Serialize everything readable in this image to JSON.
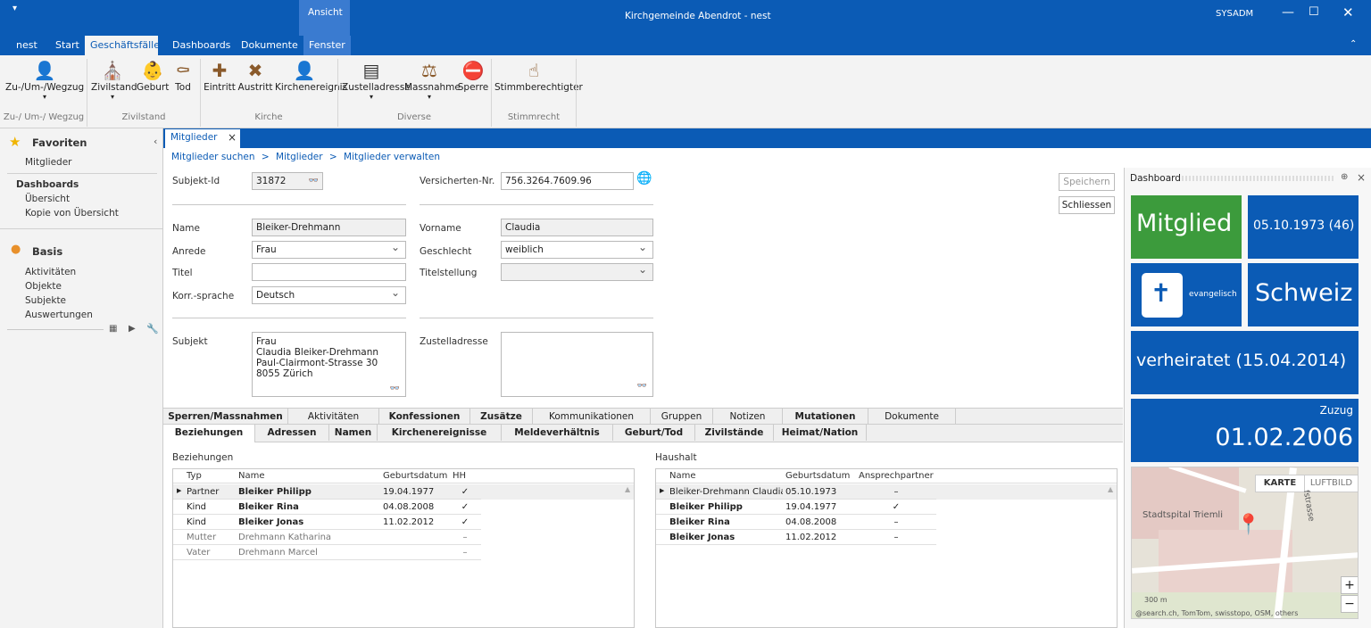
{
  "window": {
    "title": "Kirchgemeinde Abendrot - nest",
    "context_tab": "Ansicht",
    "user": "SYSADM",
    "quick_access": "▾"
  },
  "menu": {
    "tabs": [
      "nest",
      "Start",
      "Geschäftsfälle",
      "Dashboards",
      "Dokumente",
      "Fenster"
    ],
    "active": "Geschäftsfälle"
  },
  "ribbon": {
    "buttons": [
      "Zu-/Um-/Wegzug",
      "Zivilstand",
      "Geburt",
      "Tod",
      "Eintritt",
      "Austritt",
      "Kirchenereignis",
      "Zustelladresse",
      "Massnahme",
      "Sperre",
      "Stimmberechtigter"
    ],
    "groups": [
      "Zu-/ Um-/ Wegzug",
      "Zivilstand",
      "Kirche",
      "Diverse",
      "Stimmrecht"
    ]
  },
  "left": {
    "favorites_title": "Favoriten",
    "favorites_items": [
      "Mitglieder"
    ],
    "dashboards_title": "Dashboards",
    "dashboards_items": [
      "Übersicht",
      "Kopie von Übersicht"
    ],
    "basis_title": "Basis",
    "basis_items": [
      "Aktivitäten",
      "Objekte",
      "Subjekte",
      "Auswertungen"
    ]
  },
  "doc_tab": {
    "label": "Mitglieder",
    "close": "×"
  },
  "breadcrumb": [
    "Mitglieder suchen",
    ">",
    "Mitglieder",
    ">",
    "Mitglieder verwalten"
  ],
  "form": {
    "subjekt_id": {
      "label": "Subjekt-Id",
      "value": "31872"
    },
    "versicherten_nr": {
      "label": "Versicherten-Nr.",
      "value": "756.3264.7609.96"
    },
    "name": {
      "label": "Name",
      "value": "Bleiker-Drehmann"
    },
    "vorname": {
      "label": "Vorname",
      "value": "Claudia"
    },
    "anrede": {
      "label": "Anrede",
      "value": "Frau"
    },
    "geschlecht": {
      "label": "Geschlecht",
      "value": "weiblich"
    },
    "titel": {
      "label": "Titel",
      "value": ""
    },
    "titelstellung": {
      "label": "Titelstellung",
      "value": ""
    },
    "korr_sprache": {
      "label": "Korr.-sprache",
      "value": "Deutsch"
    },
    "subjekt": {
      "label": "Subjekt",
      "lines": [
        "Frau",
        "Claudia Bleiker-Drehmann",
        "Paul-Clairmont-Strasse 30",
        "8055 Zürich"
      ]
    },
    "zustelladresse": {
      "label": "Zustelladresse",
      "value": ""
    }
  },
  "actions": {
    "save": "Speichern",
    "close": "Schliessen"
  },
  "subtabs_row1": [
    "Sperren/Massnahmen",
    "Aktivitäten",
    "Konfessionen",
    "Zusätze",
    "Kommunikationen",
    "Gruppen",
    "Notizen",
    "Mutationen",
    "Dokumente"
  ],
  "subtabs_row2": [
    "Beziehungen",
    "Adressen",
    "Namen",
    "Kirchenereignisse",
    "Meldeverhältnis",
    "Geburt/Tod",
    "Zivilstände",
    "Heimat/Nation"
  ],
  "beziehungen": {
    "title": "Beziehungen",
    "columns": [
      "Typ",
      "Name",
      "Geburtsdatum",
      "HH"
    ],
    "rows": [
      [
        "Partner",
        "Bleiker Philipp",
        "19.04.1977",
        "✓"
      ],
      [
        "Kind",
        "Bleiker Rina",
        "04.08.2008",
        "✓"
      ],
      [
        "Kind",
        "Bleiker Jonas",
        "11.02.2012",
        "✓"
      ],
      [
        "Mutter",
        "Drehmann Katharina",
        "",
        "–"
      ],
      [
        "Vater",
        "Drehmann Marcel",
        "",
        "–"
      ]
    ]
  },
  "haushalt": {
    "title": "Haushalt",
    "columns": [
      "Name",
      "Geburtsdatum",
      "Ansprechpartner"
    ],
    "rows": [
      [
        "Bleiker-Drehmann Claudia",
        "05.10.1973",
        "–"
      ],
      [
        "Bleiker Philipp",
        "19.04.1977",
        "✓"
      ],
      [
        "Bleiker Rina",
        "04.08.2008",
        "–"
      ],
      [
        "Bleiker Jonas",
        "11.02.2012",
        "–"
      ]
    ]
  },
  "dashboard": {
    "title": "Dashboard",
    "status": "Mitglied",
    "birth": "05.10.1973 (46)",
    "confession": "evangelisch",
    "nation": "Schweiz",
    "civil": "verheiratet (15.04.2014)",
    "move_label": "Zuzug",
    "move_date": "01.02.2006",
    "map": {
      "btn_map": "KARTE",
      "btn_aerial": "LUFTBILD",
      "place": "Stadtspital Triemli",
      "street": "fstrasse",
      "scale": "300 m",
      "attribution": "@search.ch, TomTom, swisstopo, OSM, others"
    },
    "colors": {
      "status": "#3c9b3c",
      "tile": "#0b5bb5"
    }
  }
}
